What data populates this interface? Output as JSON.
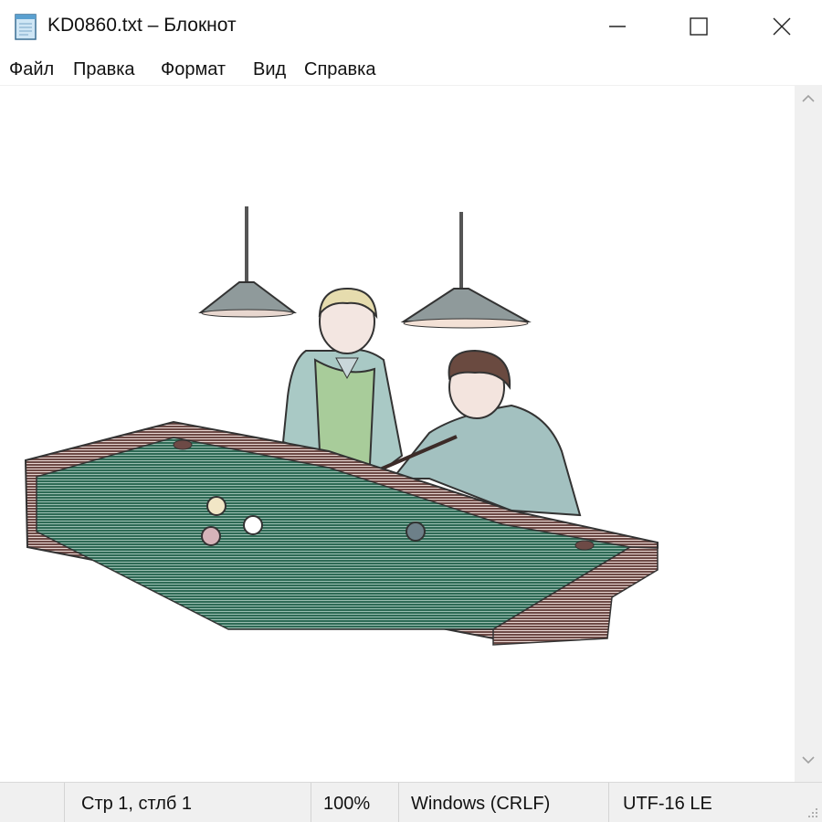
{
  "window": {
    "title": "KD0860.txt – Блокнот",
    "app_icon": "notepad-icon"
  },
  "menu": {
    "items": [
      "Файл",
      "Правка",
      "Формат",
      "Вид",
      "Справка"
    ]
  },
  "content": {
    "image_description": "clipart-billiards-players"
  },
  "status": {
    "position": "Стр 1, стлб 1",
    "zoom": "100%",
    "line_endings": "Windows (CRLF)",
    "encoding": "UTF-16 LE"
  }
}
